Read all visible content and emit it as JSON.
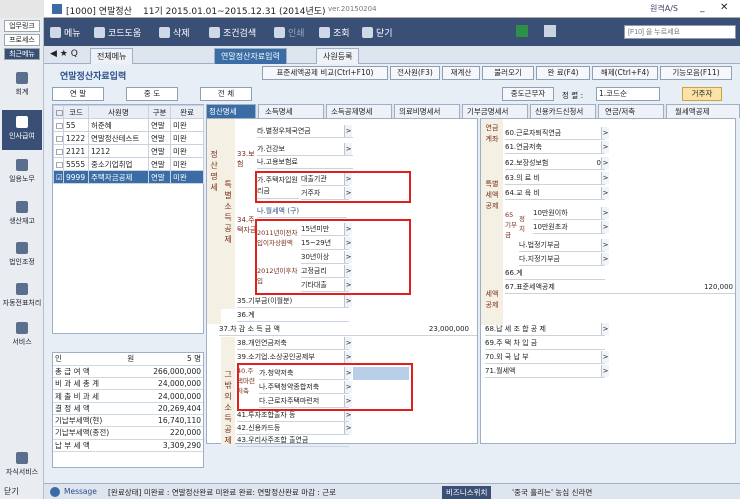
{
  "window": {
    "title": "[1000] 연말정산",
    "period": "11기 2015.01.01~2015.12.31 (2014년도)",
    "version": "ver.20150204",
    "company": "원격A/S"
  },
  "sidebar": {
    "top_buttons": [
      "업무링크",
      "프로세스",
      "최근메뉴"
    ],
    "items": [
      "회계",
      "인사급여",
      "일용노무",
      "생산재고",
      "법인조정",
      "자동전표처리",
      "서비스",
      "자식서비스"
    ],
    "close": "닫기"
  },
  "toolbar": {
    "menu": "메뉴",
    "help": "코드도움",
    "delete": "삭제",
    "search": "조건검색",
    "print": "인쇄",
    "view": "조회",
    "close": "닫기",
    "search_placeholder": "[F10] 을 누르세요"
  },
  "tabs": [
    "전체메뉴",
    "연말정산자료입력",
    "사원등록"
  ],
  "page": {
    "title": "연말정산자료입력"
  },
  "actions": [
    "표준세액공제 비교(Ctrl+F10)",
    "전사원(F3)",
    "재계산",
    "불러오기",
    "완 료(F4)",
    "해제(Ctrl+F4)",
    "기능모음(F11)"
  ],
  "filters": {
    "tabs": [
      "연 말",
      "중 도",
      "전 체"
    ],
    "midterm": "중도근무자",
    "sort_label": "정 렬 :",
    "sort_value": "1.코드순",
    "resident": "거주자"
  },
  "employee_table": {
    "headers": [
      "코드",
      "사원명",
      "구분",
      "완료"
    ],
    "rows": [
      [
        "55",
        "허준혜",
        "연말",
        "미완"
      ],
      [
        "1222",
        "연말정산테스트",
        "연말",
        "미완"
      ],
      [
        "2121",
        "1212",
        "연말",
        "미완"
      ],
      [
        "5555",
        "중소기업취업",
        "연말",
        "미완"
      ],
      [
        "9999",
        "주택자금공제",
        "연말",
        "미완"
      ]
    ]
  },
  "summary": [
    [
      "인",
      "원",
      "5 명"
    ],
    [
      "총 급 여 액",
      "",
      "266,000,000"
    ],
    [
      "비 과 세 총 계",
      "",
      "24,000,000"
    ],
    [
      "제 출 비 과 세",
      "",
      "24,000,000"
    ],
    [
      "결 정 세 액",
      "",
      "20,269,404"
    ],
    [
      "기납부세액(현)",
      "",
      "16,740,110"
    ],
    [
      "기납부세액(종전)",
      "",
      "220,000"
    ],
    [
      "납 부 세 액",
      "",
      "3,309,290"
    ]
  ],
  "detail_tabs": [
    "정산명세",
    "소득명세",
    "소득공제명세",
    "의료비명세서",
    "기부금명세서",
    "신용카드신청서",
    "연금/저축",
    "월세액공제"
  ],
  "left_rows": [
    "라.별정우체국연금",
    "가.건강보",
    "나.고용보험료",
    "가.주택자입원리금",
    "대출기관",
    "거주자",
    "나.월세액 (구)",
    "15년미만",
    "15~29년",
    "30년이상",
    "고정금리",
    "기타대출",
    "35.기부금(이월분)",
    "36.계",
    "37.차 감 소 득 금 액",
    "38.개인연금저축",
    "39.소기업.소상공인공제부",
    "가.청약저축",
    "나.주택청약종합저축",
    "다.근로자주택마련저",
    "41.투자조합출자 등",
    "42.신용카드등",
    "43.우리사주조합 출연금",
    "44.우리사주조합 기부금"
  ],
  "left_labels": {
    "col1": "정 산 명 세",
    "col2": "특 별 소 득 공 제",
    "col2b": "그 밖 의 소득공제",
    "ins": "33.보험",
    "house": "34.주택자금",
    "y2011": "2011년이전차입이자상환액",
    "y2012": "2012년이후차입",
    "savings": "40.주택마련저축",
    "income_amt": "23,000,000"
  },
  "right_rows": [
    "60.근로자퇴직연금",
    "61.연금저축",
    "62.보장성보험",
    "63.의 료 비",
    "64.교 육 비",
    "10만원이하",
    "10만원초과",
    "나.법정기부금",
    "다.지정기부금",
    "66.계",
    "67.표준세액공제",
    "68.납 세 조 합 공 제",
    "69.주 택 차 입 금",
    "70.외 국 납 부",
    "71.월세액"
  ],
  "right_labels": {
    "pension": "연금계좌",
    "special": "특별세액공제",
    "tax": "세액공제",
    "donation": "65기부금",
    "political": "정치",
    "zero": "0",
    "std": "120,000"
  },
  "status": {
    "message": "Message",
    "text": "[완료상태] 미완료 : 연말정산완료 미완료  완료: 연말정산완료 마감 : 근로",
    "biz": "비즈니스위치",
    "news": "'중국 흘리는' 농심 신라면"
  },
  "colors": {
    "accent": "#3a4f75",
    "highlight": "#e0201c",
    "selected": "#3a6da5"
  }
}
